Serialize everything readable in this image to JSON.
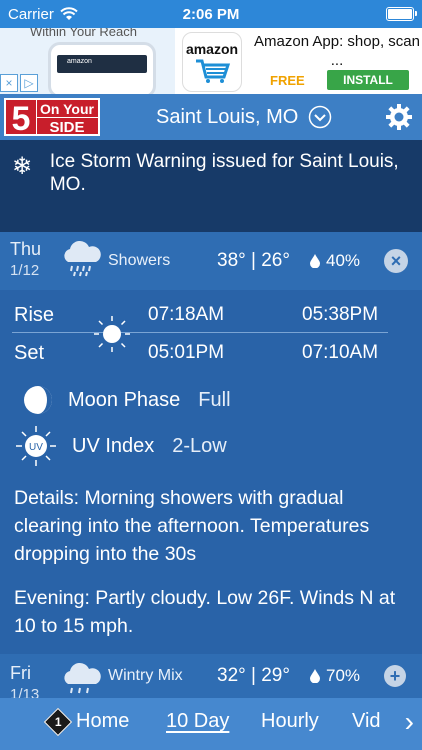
{
  "status_bar": {
    "carrier": "Carrier",
    "time": "2:06 PM"
  },
  "ad": {
    "tagline": "Within Your Reach",
    "phone_text": "amazon",
    "icon_brand": "amazon",
    "title": "Amazon App: shop, scan ...",
    "price": "FREE",
    "install_label": "INSTALL",
    "badges": [
      "×",
      "▷"
    ]
  },
  "header": {
    "logo_text": "On Your SIDE",
    "logo_number": "5",
    "location": "Saint Louis, MO"
  },
  "warning": {
    "text": "Ice Storm Warning issued for Saint Louis, MO."
  },
  "days": [
    {
      "day": "Thu",
      "date": "1/12",
      "condition": "Showers",
      "temps": "38° | 26°",
      "precip": "40%",
      "toggle": "×",
      "icon": "rain-cloud-icon"
    },
    {
      "day": "Fri",
      "date": "1/13",
      "condition": "Wintry Mix",
      "temps": "32° | 29°",
      "precip": "70%",
      "toggle": "+",
      "icon": "wintry-mix-icon"
    }
  ],
  "details": {
    "rise_label": "Rise",
    "set_label": "Set",
    "sunrise": "07:18AM",
    "sunset": "05:01PM",
    "moonrise": "05:38PM",
    "moonset": "07:10AM",
    "moon_phase_label": "Moon Phase",
    "moon_phase_value": "Full",
    "uv_label": "UV Index",
    "uv_value": "2-Low",
    "uv_icon_text": "UV",
    "details_text": "Details: Morning showers with gradual clearing into the afternoon. Temperatures dropping into the 30s",
    "evening_text": "Evening: Partly cloudy. Low 26F. Winds N at 10 to 15 mph."
  },
  "nav": {
    "badge": "1",
    "tabs": [
      "Home",
      "10 Day",
      "Hourly",
      "Vid"
    ],
    "active_tab": "10 Day"
  },
  "colors": {
    "status_bar": "#2d87d8",
    "header": "#3d7fc5",
    "warning": "#173a68",
    "details": "#2963a8",
    "nav": "#4688cf"
  }
}
